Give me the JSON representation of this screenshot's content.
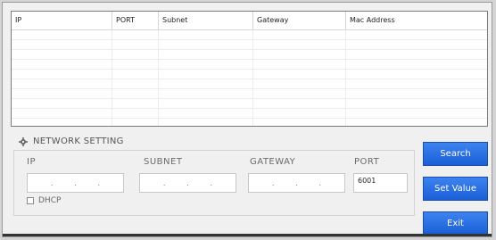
{
  "table": {
    "columns": [
      "IP",
      "PORT",
      "Subnet",
      "Gateway",
      "Mac Address"
    ],
    "rows": []
  },
  "network_setting": {
    "title": "NETWORK SETTING",
    "ip_label": "IP",
    "subnet_label": "SUBNET",
    "gateway_label": "GATEWAY",
    "port_label": "PORT",
    "ip_value": ". . .",
    "subnet_value": ". . .",
    "gateway_value": ". . .",
    "port_value": "6001",
    "dhcp_label": "DHCP",
    "dhcp_checked": false
  },
  "buttons": {
    "search": "Search",
    "set_value": "Set Value",
    "exit": "Exit"
  },
  "colors": {
    "button_blue": "#2a6fe6",
    "window_bg": "#f0f0f0"
  }
}
